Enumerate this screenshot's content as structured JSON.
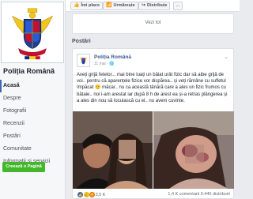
{
  "sidebar": {
    "page_name": "Poliția Română",
    "nav": [
      {
        "label": "Acasă",
        "active": true
      },
      {
        "label": "Despre",
        "active": false
      },
      {
        "label": "Fotografii",
        "active": false
      },
      {
        "label": "Recenzii",
        "active": false
      },
      {
        "label": "Postări",
        "active": false
      },
      {
        "label": "Comunitate",
        "active": false
      },
      {
        "label": "Informații și servicii",
        "active": false
      }
    ],
    "create_page_label": "Creează o Pagină"
  },
  "topbar": {
    "like_label": "Îmi place",
    "follow_label": "Urmărește",
    "share_label": "Distribuie",
    "more_label": "..."
  },
  "see_all_label": "Vezi tot",
  "posts_heading": "Postări",
  "post": {
    "author": "Poliția Română",
    "time": "11 mai",
    "text_lines": [
      "Aveți grijă fetelor... mai bine luați un băiat urât fizic dar să aibe grijă de",
      "voi.. pentru că aparențele fizice vor dispărea.. și veți rămâne cu sufletul",
      "împăcat 🙂 măcar.. nu ca această tânără care a ales un fizic frumos cu",
      "bătaie.. noi i-am arestat iar după 8 h de arest ea și-a retras plângerea și",
      "a ales din nou să locuiască cu el.. nu avem cuvinte."
    ],
    "reactions_count": "3,5 K",
    "comments_count": "1,4 K comentarii",
    "shares_count": "9.440 distribuiri"
  },
  "colors": {
    "accent": "#4267b2",
    "link": "#385898",
    "create_button": "#42b72a"
  }
}
